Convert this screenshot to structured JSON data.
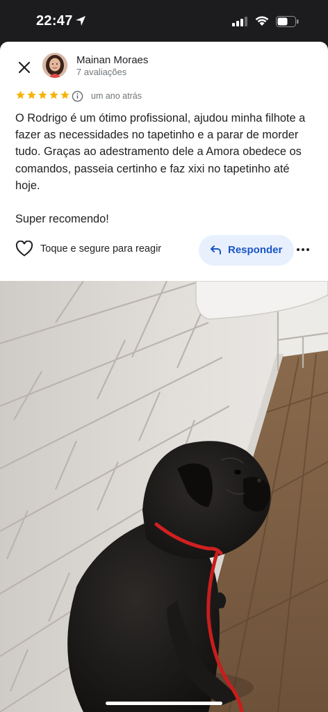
{
  "status_bar": {
    "time": "22:47"
  },
  "review": {
    "reviewer_name": "Mainan Moraes",
    "review_count": "7 avaliações",
    "rating": 5,
    "date": "um ano atrás",
    "text": "O Rodrigo é um ótimo profissional, ajudou minha filhote a fazer as necessidades no tapetinho e a parar de morder tudo. Graças ao adestramento dele a Amora obedece os comandos, passeia certinho e faz xixi no tapetinho até hoje.\n\nSuper recomendo!"
  },
  "actions": {
    "react_label": "Toque e segure para reagir",
    "reply_label": "Responder"
  },
  "colors": {
    "star": "#f4b400",
    "reply_bg": "#e8f0fe",
    "reply_text": "#1a56c4"
  },
  "icons": [
    "close-icon",
    "info-icon",
    "heart-icon",
    "reply-arrow-icon",
    "more-icon",
    "star-icon"
  ]
}
